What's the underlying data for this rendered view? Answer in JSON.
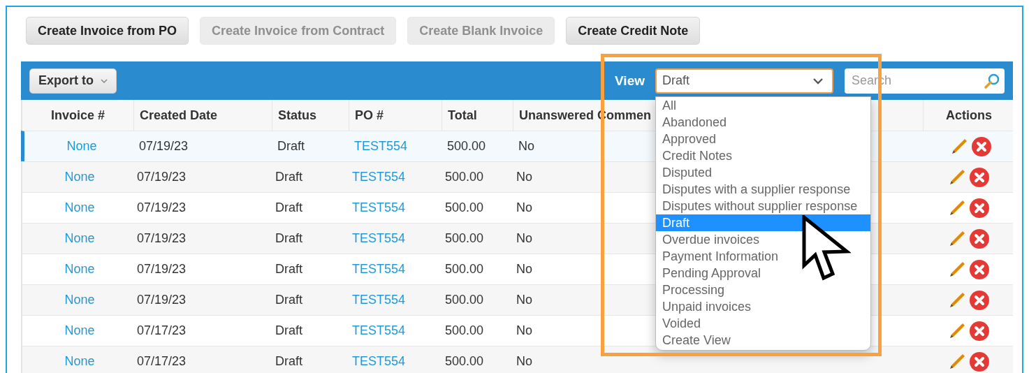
{
  "action_buttons": [
    {
      "label": "Create Invoice from PO",
      "disabled": false
    },
    {
      "label": "Create Invoice from Contract",
      "disabled": true
    },
    {
      "label": "Create Blank Invoice",
      "disabled": true
    },
    {
      "label": "Create Credit Note",
      "disabled": false
    }
  ],
  "grid": {
    "export_button": "Export to",
    "view_label": "View",
    "view_select": {
      "value": "Draft",
      "expanded": true
    },
    "search": {
      "placeholder": "Search"
    },
    "columns": [
      "Invoice #",
      "Created Date",
      "Status",
      "PO #",
      "Total",
      "Unanswered Commen",
      "Actions"
    ],
    "rows": [
      {
        "selected": true,
        "invoice": "None",
        "created": "07/19/23",
        "status": "Draft",
        "po": "TEST554",
        "total": "500.00",
        "unanswered": "No"
      },
      {
        "selected": false,
        "invoice": "None",
        "created": "07/19/23",
        "status": "Draft",
        "po": "TEST554",
        "total": "500.00",
        "unanswered": "No"
      },
      {
        "selected": false,
        "invoice": "None",
        "created": "07/19/23",
        "status": "Draft",
        "po": "TEST554",
        "total": "500.00",
        "unanswered": "No"
      },
      {
        "selected": false,
        "invoice": "None",
        "created": "07/19/23",
        "status": "Draft",
        "po": "TEST554",
        "total": "500.00",
        "unanswered": "No"
      },
      {
        "selected": false,
        "invoice": "None",
        "created": "07/19/23",
        "status": "Draft",
        "po": "TEST554",
        "total": "500.00",
        "unanswered": "No"
      },
      {
        "selected": false,
        "invoice": "None",
        "created": "07/19/23",
        "status": "Draft",
        "po": "TEST554",
        "total": "500.00",
        "unanswered": "No"
      },
      {
        "selected": false,
        "invoice": "None",
        "created": "07/17/23",
        "status": "Draft",
        "po": "TEST554",
        "total": "500.00",
        "unanswered": "No"
      },
      {
        "selected": false,
        "invoice": "None",
        "created": "07/17/23",
        "status": "Draft",
        "po": "TEST554",
        "total": "500.00",
        "unanswered": "No"
      }
    ]
  },
  "view_options": [
    {
      "label": "All",
      "selected": false
    },
    {
      "label": "Abandoned",
      "selected": false
    },
    {
      "label": "Approved",
      "selected": false
    },
    {
      "label": "Credit Notes",
      "selected": false
    },
    {
      "label": "Disputed",
      "selected": false
    },
    {
      "label": "Disputes with a supplier response",
      "selected": false
    },
    {
      "label": "Disputes without supplier response",
      "selected": false
    },
    {
      "label": "Draft",
      "selected": true
    },
    {
      "label": "Overdue invoices",
      "selected": false
    },
    {
      "label": "Payment Information",
      "selected": false
    },
    {
      "label": "Pending Approval",
      "selected": false
    },
    {
      "label": "Processing",
      "selected": false
    },
    {
      "label": "Unpaid invoices",
      "selected": false
    },
    {
      "label": "Voided",
      "selected": false
    },
    {
      "label": "Create View",
      "selected": false
    }
  ]
}
